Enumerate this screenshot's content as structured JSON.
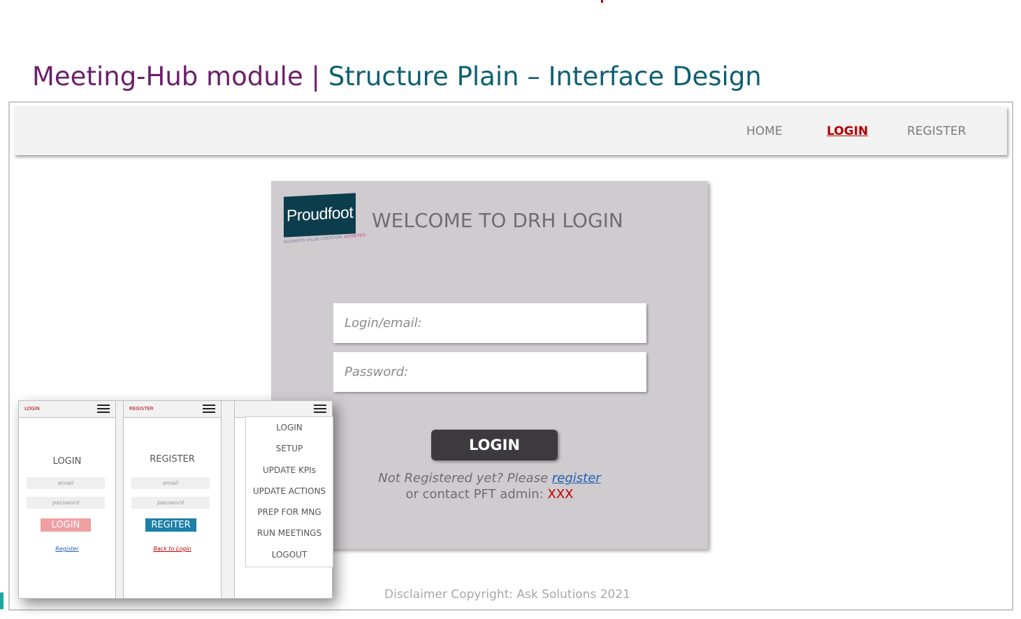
{
  "slide": {
    "title_part1": "Meeting-Hub module | ",
    "title_part2": "Structure Plain – Interface Design"
  },
  "nav": {
    "home": "HOME",
    "login": "LOGIN",
    "register": "REGISTER"
  },
  "login_panel": {
    "logo_text": "Proudfoot",
    "logo_tagline": "BUSINESS VALUE CREATION. ",
    "logo_tagline_accent": "ACHIEVED.",
    "welcome": "WELCOME TO DRH LOGIN",
    "email_placeholder": "Login/email:",
    "password_placeholder": "Password:",
    "login_button": "LOGIN",
    "not_registered": "Not Registered yet? Please ",
    "register_link": "register ",
    "contact": "or contact PFT admin: ",
    "contact_value": "XXX"
  },
  "disclaimer": "Disclaimer Copyright: Ask Solutions 2021",
  "mobile": {
    "login_screen": {
      "header": "LOGIN",
      "heading": "LOGIN",
      "email": "email",
      "password": "password",
      "button": "LOGIN",
      "button_color": "#f0a0a3",
      "link": "Register"
    },
    "register_screen": {
      "header": "REGISTER",
      "heading": "REGISTER",
      "email": "email",
      "password": "password",
      "button": "REGITER",
      "button_color": "#1e7fa8",
      "link": "Back to Login"
    },
    "menu_screen": {
      "items": [
        "LOGIN",
        "SETUP",
        "UPDATE KPIs",
        "UPDATE ACTIONS",
        "PREP FOR MNG",
        "RUN MEETINGS",
        "LOGOUT"
      ]
    }
  },
  "colors": {
    "title_purple": "#6b1f6b",
    "title_teal": "#0d5f73",
    "nav_active": "#b30000",
    "panel_bg": "#d0cbcf",
    "login_button": "#3d3a3d",
    "link_blue": "#1f5fb0",
    "accent_red": "#c00000"
  }
}
